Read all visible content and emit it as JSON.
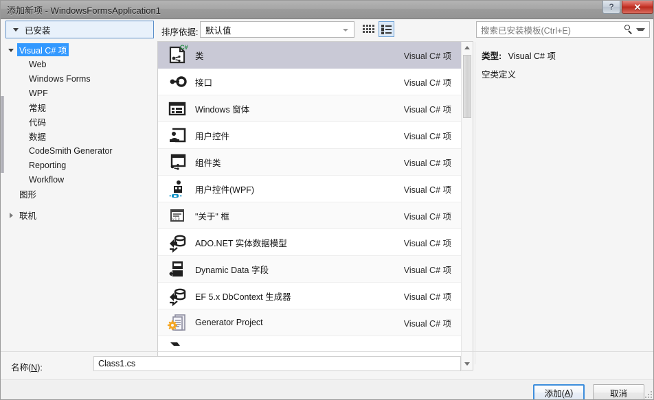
{
  "window": {
    "title": "添加新项 - WindowsFormsApplication1",
    "help_button": "?",
    "close_button": "✕"
  },
  "sidebar": {
    "header": {
      "label": "已安装",
      "expanded": true
    },
    "items": [
      {
        "label": "Visual C# 项",
        "level": 1,
        "twisty": "open",
        "selected": true
      },
      {
        "label": "Web",
        "level": 2,
        "twisty": "none",
        "selected": false
      },
      {
        "label": "Windows Forms",
        "level": 2,
        "twisty": "none",
        "selected": false
      },
      {
        "label": "WPF",
        "level": 2,
        "twisty": "none",
        "selected": false
      },
      {
        "label": "常规",
        "level": 2,
        "twisty": "none",
        "selected": false
      },
      {
        "label": "代码",
        "level": 2,
        "twisty": "none",
        "selected": false
      },
      {
        "label": "数据",
        "level": 2,
        "twisty": "none",
        "selected": false
      },
      {
        "label": "CodeSmith Generator",
        "level": 2,
        "twisty": "none",
        "selected": false
      },
      {
        "label": "Reporting",
        "level": 2,
        "twisty": "none",
        "selected": false
      },
      {
        "label": "Workflow",
        "level": 2,
        "twisty": "none",
        "selected": false
      },
      {
        "label": "图形",
        "level": 1.5,
        "twisty": "none",
        "selected": false
      },
      {
        "label": "联机",
        "level": 1,
        "twisty": "closed",
        "selected": false
      }
    ]
  },
  "toolbar": {
    "sort_label": "排序依据:",
    "sort_value": "默认值",
    "view_grid_icon": "medium-icons-icon",
    "view_list_icon": "details-list-icon",
    "view_active": "list"
  },
  "search": {
    "placeholder": "搜索已安装模板(Ctrl+E)",
    "icon": "search-icon",
    "dropdown_icon": "chevron-down-icon"
  },
  "list": {
    "type_column": "Visual C# 项",
    "items": [
      {
        "name": "类",
        "type": "Visual C# 项",
        "icon": "class-csharp-icon",
        "selected": true
      },
      {
        "name": "接口",
        "type": "Visual C# 项",
        "icon": "interface-icon",
        "selected": false
      },
      {
        "name": "Windows 窗体",
        "type": "Visual C# 项",
        "icon": "windows-form-icon",
        "selected": false
      },
      {
        "name": "用户控件",
        "type": "Visual C# 项",
        "icon": "user-control-icon",
        "selected": false
      },
      {
        "name": "组件类",
        "type": "Visual C# 项",
        "icon": "component-class-icon",
        "selected": false
      },
      {
        "name": "用户控件(WPF)",
        "type": "Visual C# 项",
        "icon": "wpf-user-control-icon",
        "selected": false
      },
      {
        "name": "\"关于\" 框",
        "type": "Visual C# 项",
        "icon": "about-box-icon",
        "selected": false
      },
      {
        "name": "ADO.NET 实体数据模型",
        "type": "Visual C# 项",
        "icon": "ado-net-entity-model-icon",
        "selected": false
      },
      {
        "name": "Dynamic Data 字段",
        "type": "Visual C# 项",
        "icon": "dynamic-data-field-icon",
        "selected": false
      },
      {
        "name": "EF 5.x DbContext 生成器",
        "type": "Visual C# 项",
        "icon": "ef-dbcontext-generator-icon",
        "selected": false
      },
      {
        "name": "Generator Project",
        "type": "Visual C# 项",
        "icon": "generator-project-icon",
        "selected": false
      }
    ]
  },
  "details": {
    "type_label": "类型:",
    "type_value": "Visual C# 项",
    "description": "空类定义"
  },
  "footer": {
    "name_label_pre": "名称(",
    "name_label_key": "N",
    "name_label_post": "):",
    "name_value": "Class1.cs",
    "add_label_pre": "添加(",
    "add_label_key": "A",
    "add_label_post": ")",
    "cancel_label": "取消"
  },
  "colors": {
    "accent_blue": "#3399ff",
    "focus_border": "#3c8ddc",
    "selected_row": "#c9c9d6",
    "installed_header_bg": "#e8f1fb",
    "close_button_red": "#cf4437"
  }
}
